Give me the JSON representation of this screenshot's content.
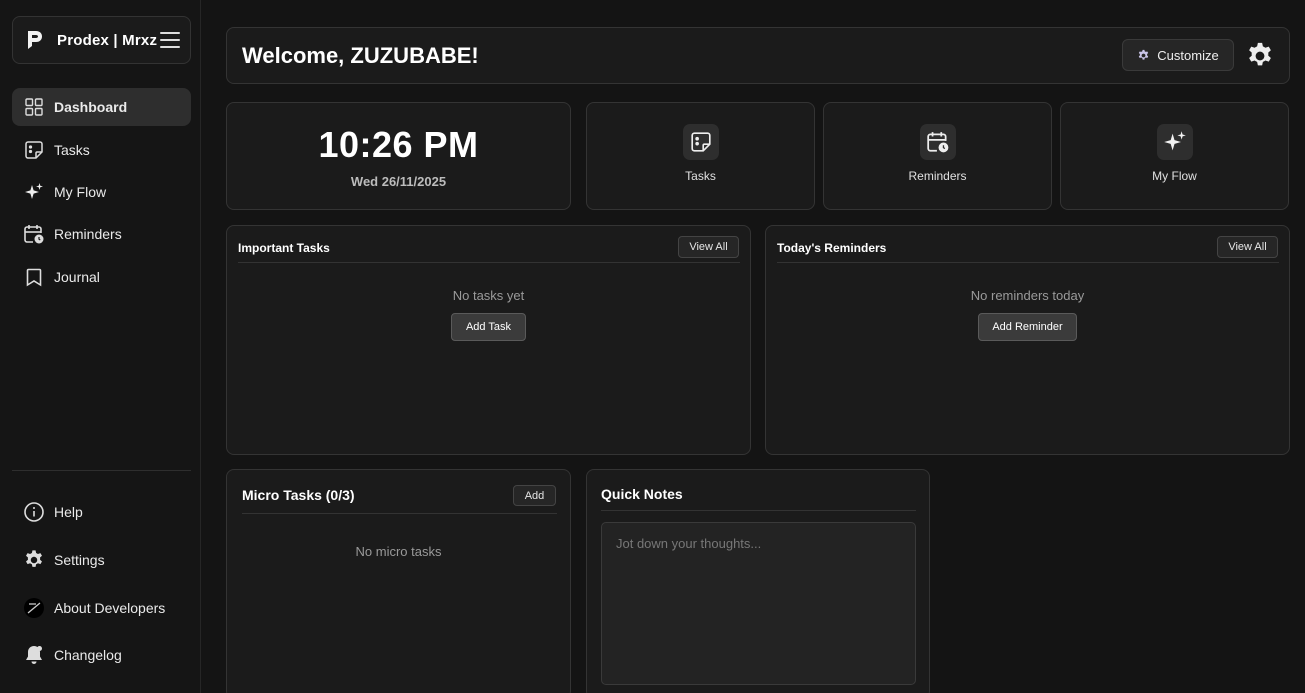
{
  "sidebar": {
    "brand": "Prodex | Mrxz",
    "nav": [
      {
        "label": "Dashboard",
        "icon": "grid-icon",
        "active": true
      },
      {
        "label": "Tasks",
        "icon": "sticky-note-icon"
      },
      {
        "label": "My Flow",
        "icon": "sparkles-icon"
      },
      {
        "label": "Reminders",
        "icon": "calendar-clock-icon"
      },
      {
        "label": "Journal",
        "icon": "bookmark-icon"
      }
    ],
    "bottom": [
      {
        "label": "Help",
        "icon": "info-icon"
      },
      {
        "label": "Settings",
        "icon": "gear-icon"
      },
      {
        "label": "About Developers",
        "icon": "developer-logo-icon"
      },
      {
        "label": "Changelog",
        "icon": "bell-icon"
      }
    ]
  },
  "header": {
    "welcome": "Welcome, ZUZUBABE!",
    "customize_label": "Customize"
  },
  "clock": {
    "time": "10:26 PM",
    "date": "Wed 26/11/2025"
  },
  "quick_links": [
    {
      "label": "Tasks",
      "icon": "sticky-note-icon"
    },
    {
      "label": "Reminders",
      "icon": "calendar-clock-icon"
    },
    {
      "label": "My Flow",
      "icon": "sparkles-icon"
    }
  ],
  "important_tasks": {
    "title": "Important Tasks",
    "view_all": "View All",
    "empty": "No tasks yet",
    "add": "Add Task"
  },
  "reminders": {
    "title": "Today's Reminders",
    "view_all": "View All",
    "empty": "No reminders today",
    "add": "Add Reminder"
  },
  "micro_tasks": {
    "title": "Micro Tasks (0/3)",
    "add": "Add",
    "empty": "No micro tasks"
  },
  "quick_notes": {
    "title": "Quick Notes",
    "placeholder": "Jot down your thoughts...",
    "value": ""
  }
}
